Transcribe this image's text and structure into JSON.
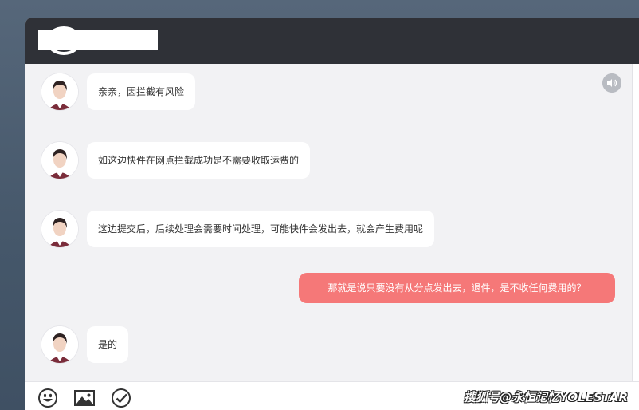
{
  "header": {
    "logo_icon": "express-logo-icon"
  },
  "messages": [
    {
      "from": "agent",
      "text": "亲亲，因拦截有风险"
    },
    {
      "from": "agent",
      "text": "如这边快件在网点拦截成功是不需要收取运费的"
    },
    {
      "from": "agent",
      "text": "这边提交后，后续处理会需要时间处理，可能快件会发出去，就会产生费用呢"
    },
    {
      "from": "user",
      "text": "那就是说只要没有从分点发出去，退件，是不收任何费用的？"
    },
    {
      "from": "agent",
      "text": "是的"
    }
  ],
  "toolbar": {
    "icons": [
      "emoji-icon",
      "image-icon",
      "check-circle-icon"
    ]
  },
  "watermark": "搜狐号@永恒记忆YOLESTAR",
  "colors": {
    "header_bg": "#2f3137",
    "chat_bg": "#f2f2f4",
    "user_bubble": "#f57878",
    "agent_bubble": "#ffffff"
  }
}
